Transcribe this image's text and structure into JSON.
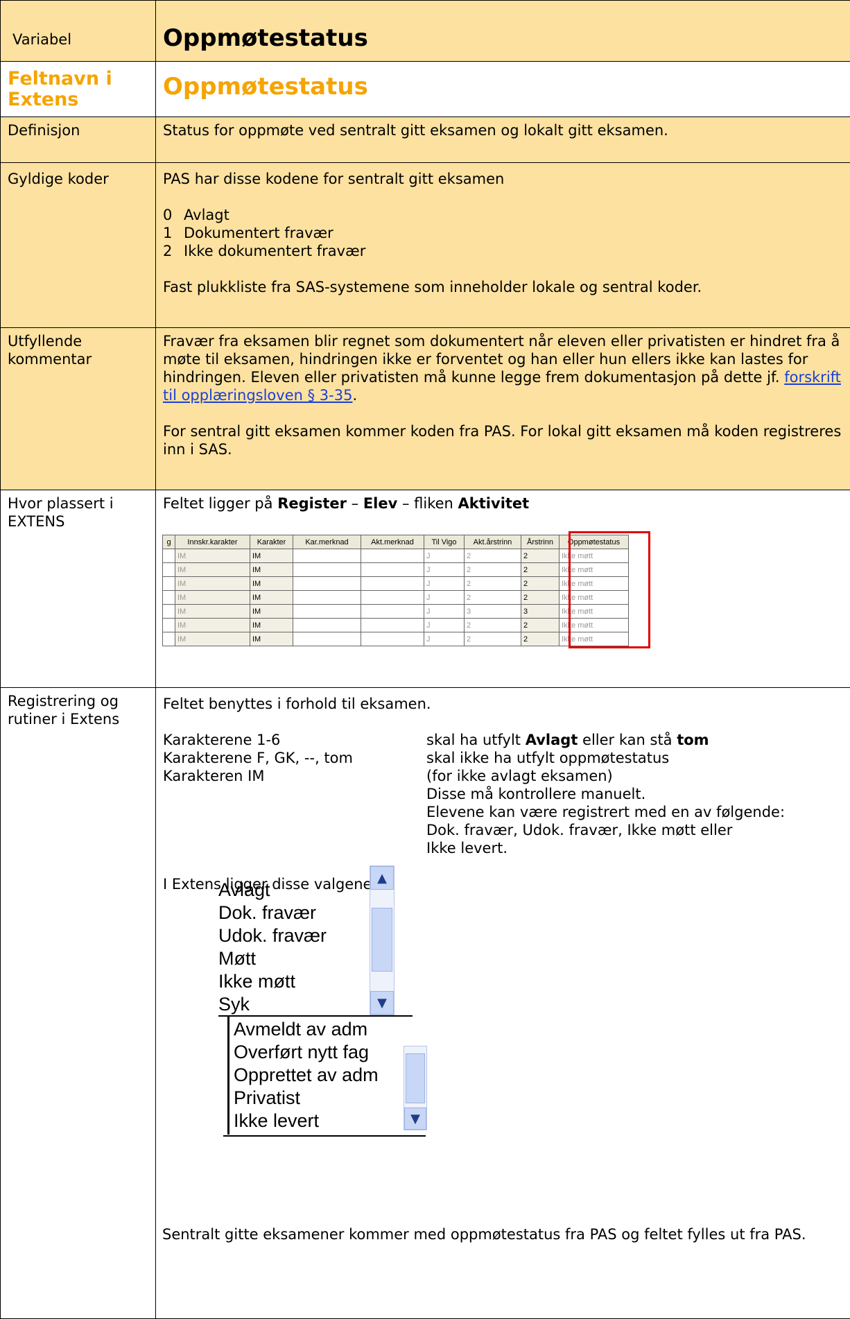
{
  "rows": {
    "variabel": {
      "label": "Variabel",
      "value": "Oppmøtestatus"
    },
    "feltnavn": {
      "label": "Feltnavn i Extens",
      "value": "Oppmøtestatus"
    },
    "definisjon": {
      "label": "Definisjon",
      "value": "Status for oppmøte ved sentralt gitt eksamen og lokalt gitt eksamen."
    },
    "gyldige": {
      "label": "Gyldige koder",
      "intro": "PAS har disse kodene for sentralt gitt eksamen",
      "codes": [
        {
          "code": "0",
          "text": "Avlagt"
        },
        {
          "code": "1",
          "text": "Dokumentert fravær"
        },
        {
          "code": "2",
          "text": "Ikke dokumentert fravær"
        }
      ],
      "outro": "Fast plukkliste fra SAS-systemene som inneholder lokale og sentral koder."
    },
    "utfyllende": {
      "label": "Utfyllende kommentar",
      "text_before_link": "Fravær fra eksamen blir regnet som dokumentert når eleven eller privatisten er hindret fra å møte til eksamen, hindringen ikke er forventet og han eller hun ellers ikke kan lastes for hindringen. Eleven eller privatisten må kunne legge frem dokumentasjon på dette jf. ",
      "link": "forskrift til opplæringsloven § 3-35",
      "text_after_link": ".",
      "para2": "For sentral gitt eksamen kommer koden fra PAS. For lokal gitt eksamen må koden registreres inn i SAS."
    },
    "hvor": {
      "label": "Hvor plassert i EXTENS",
      "prefix": "Feltet ligger på ",
      "b1": "Register",
      "sep1": " – ",
      "b2": "Elev",
      "sep2": " – fliken ",
      "b3": "Aktivitet"
    },
    "registrering": {
      "label": "Registrering og rutiner i Extens",
      "intro": "Feltet benyttes i forhold til eksamen.",
      "r1_left": "Karakterene 1-6",
      "r1_right_pre": "skal ha utfylt ",
      "r1_right_b1": "Avlagt",
      "r1_right_mid": " eller kan stå ",
      "r1_right_b2": "tom",
      "r2_left": "Karakterene F, GK, --, tom",
      "r2_right": "skal ikke ha utfylt oppmøtestatus",
      "r3_left": "Karakteren IM",
      "r3_right": "(for ikke avlagt eksamen)",
      "r4_right": "Disse må kontrollere manuelt.",
      "r5_right": "Elevene kan være registrert med en av følgende:",
      "r6_right": "Dok. fravær, Udok. fravær, Ikke møtt eller",
      "r7_right": "Ikke levert.",
      "valg_intro": "I Extens ligger disse valgene:",
      "list1": [
        "Avlagt",
        "Dok. fravær",
        "Udok. fravær",
        "Møtt",
        "Ikke møtt",
        "Syk"
      ],
      "list2": [
        "Avmeldt av adm",
        "Overført nytt fag",
        "Opprettet av adm",
        "Privatist",
        "Ikke levert"
      ],
      "closing": "Sentralt gitte eksamener kommer med oppmøtestatus fra PAS og feltet fylles ut fra PAS."
    }
  },
  "register_table": {
    "headers": [
      "g",
      "Innskr.karakter",
      "Karakter",
      "Kar.merknad",
      "Akt.merknad",
      "Til Vigo",
      "Akt.årstrinn",
      "Årstrinn",
      "Oppmøtestatus"
    ],
    "rows": [
      [
        "",
        "IM",
        "IM",
        "",
        "",
        "J",
        "2",
        "2",
        "Ikke møtt"
      ],
      [
        "",
        "IM",
        "IM",
        "",
        "",
        "J",
        "2",
        "2",
        "Ikke møtt"
      ],
      [
        "",
        "IM",
        "IM",
        "",
        "",
        "J",
        "2",
        "2",
        "Ikke møtt"
      ],
      [
        "",
        "IM",
        "IM",
        "",
        "",
        "J",
        "2",
        "2",
        "Ikke møtt"
      ],
      [
        "",
        "IM",
        "IM",
        "",
        "",
        "J",
        "3",
        "3",
        "Ikke møtt"
      ],
      [
        "",
        "IM",
        "IM",
        "",
        "",
        "J",
        "2",
        "2",
        "Ikke møtt"
      ],
      [
        "",
        "IM",
        "IM",
        "",
        "",
        "J",
        "2",
        "2",
        "Ikke møtt"
      ]
    ]
  },
  "colors": {
    "yellow": "#fce1a0",
    "orange": "#f5a400",
    "link": "#1a3fd6",
    "highlight": "#e00000"
  }
}
